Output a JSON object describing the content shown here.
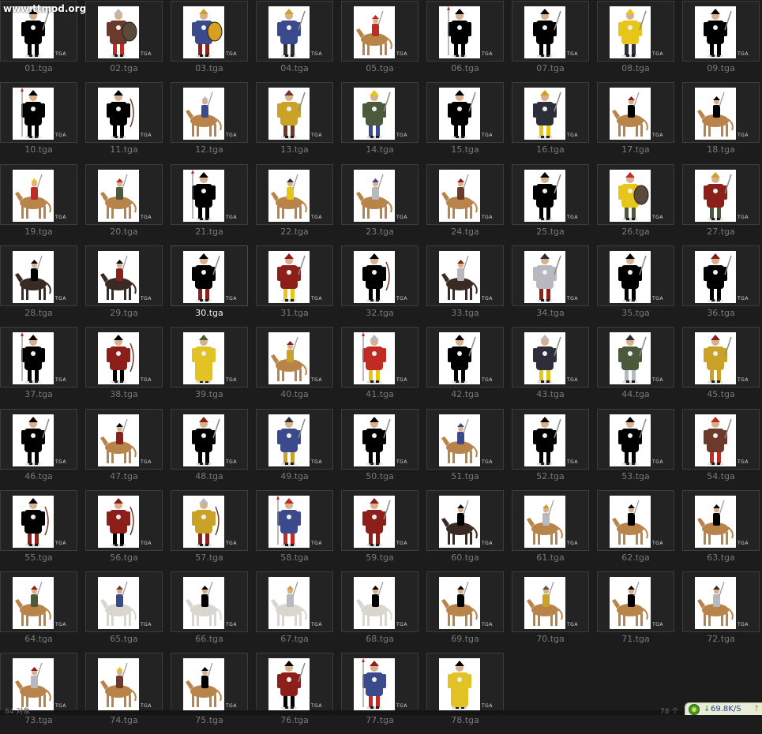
{
  "watermark": "www.ttmod.org",
  "thumbnail_badge": "TGA",
  "selected_index": 29,
  "files": [
    {
      "name": "01.tga",
      "subject": "infantry"
    },
    {
      "name": "02.tga",
      "subject": "infantry-shield"
    },
    {
      "name": "03.tga",
      "subject": "tiger-shield"
    },
    {
      "name": "04.tga",
      "subject": "infantry"
    },
    {
      "name": "05.tga",
      "subject": "cavalry"
    },
    {
      "name": "06.tga",
      "subject": "spearman"
    },
    {
      "name": "07.tga",
      "subject": "infantry"
    },
    {
      "name": "08.tga",
      "subject": "infantry"
    },
    {
      "name": "09.tga",
      "subject": "infantry"
    },
    {
      "name": "10.tga",
      "subject": "spearman"
    },
    {
      "name": "11.tga",
      "subject": "archer"
    },
    {
      "name": "12.tga",
      "subject": "cavalry"
    },
    {
      "name": "13.tga",
      "subject": "infantry"
    },
    {
      "name": "14.tga",
      "subject": "infantry"
    },
    {
      "name": "15.tga",
      "subject": "infantry"
    },
    {
      "name": "16.tga",
      "subject": "infantry"
    },
    {
      "name": "17.tga",
      "subject": "cavalry"
    },
    {
      "name": "18.tga",
      "subject": "cavalry"
    },
    {
      "name": "19.tga",
      "subject": "cavalry"
    },
    {
      "name": "20.tga",
      "subject": "cavalry"
    },
    {
      "name": "21.tga",
      "subject": "spearman"
    },
    {
      "name": "22.tga",
      "subject": "cavalry"
    },
    {
      "name": "23.tga",
      "subject": "cavalry"
    },
    {
      "name": "24.tga",
      "subject": "cavalry"
    },
    {
      "name": "25.tga",
      "subject": "infantry"
    },
    {
      "name": "26.tga",
      "subject": "infantry-shield"
    },
    {
      "name": "27.tga",
      "subject": "infantry"
    },
    {
      "name": "28.tga",
      "subject": "cavalry-dark"
    },
    {
      "name": "29.tga",
      "subject": "cavalry-dark"
    },
    {
      "name": "30.tga",
      "subject": "infantry"
    },
    {
      "name": "31.tga",
      "subject": "infantry"
    },
    {
      "name": "32.tga",
      "subject": "archer"
    },
    {
      "name": "33.tga",
      "subject": "cavalry-dark"
    },
    {
      "name": "34.tga",
      "subject": "infantry"
    },
    {
      "name": "35.tga",
      "subject": "infantry"
    },
    {
      "name": "36.tga",
      "subject": "infantry"
    },
    {
      "name": "37.tga",
      "subject": "spearman"
    },
    {
      "name": "38.tga",
      "subject": "archer"
    },
    {
      "name": "39.tga",
      "subject": "robe"
    },
    {
      "name": "40.tga",
      "subject": "cavalry"
    },
    {
      "name": "41.tga",
      "subject": "spearman"
    },
    {
      "name": "42.tga",
      "subject": "infantry"
    },
    {
      "name": "43.tga",
      "subject": "infantry"
    },
    {
      "name": "44.tga",
      "subject": "infantry"
    },
    {
      "name": "45.tga",
      "subject": "infantry"
    },
    {
      "name": "46.tga",
      "subject": "infantry"
    },
    {
      "name": "47.tga",
      "subject": "cavalry"
    },
    {
      "name": "48.tga",
      "subject": "infantry"
    },
    {
      "name": "49.tga",
      "subject": "infantry"
    },
    {
      "name": "50.tga",
      "subject": "infantry"
    },
    {
      "name": "51.tga",
      "subject": "cavalry"
    },
    {
      "name": "52.tga",
      "subject": "infantry"
    },
    {
      "name": "53.tga",
      "subject": "infantry"
    },
    {
      "name": "54.tga",
      "subject": "infantry"
    },
    {
      "name": "55.tga",
      "subject": "archer"
    },
    {
      "name": "56.tga",
      "subject": "archer"
    },
    {
      "name": "57.tga",
      "subject": "archer"
    },
    {
      "name": "58.tga",
      "subject": "spearman"
    },
    {
      "name": "59.tga",
      "subject": "infantry"
    },
    {
      "name": "60.tga",
      "subject": "cavalry-dark"
    },
    {
      "name": "61.tga",
      "subject": "cavalry"
    },
    {
      "name": "62.tga",
      "subject": "cavalry"
    },
    {
      "name": "63.tga",
      "subject": "cavalry"
    },
    {
      "name": "64.tga",
      "subject": "cavalry"
    },
    {
      "name": "65.tga",
      "subject": "cavalry-white"
    },
    {
      "name": "66.tga",
      "subject": "cavalry-white"
    },
    {
      "name": "67.tga",
      "subject": "cavalry-white"
    },
    {
      "name": "68.tga",
      "subject": "cavalry-white"
    },
    {
      "name": "69.tga",
      "subject": "cavalry"
    },
    {
      "name": "70.tga",
      "subject": "cavalry"
    },
    {
      "name": "71.tga",
      "subject": "cavalry"
    },
    {
      "name": "72.tga",
      "subject": "cavalry"
    },
    {
      "name": "73.tga",
      "subject": "cavalry"
    },
    {
      "name": "74.tga",
      "subject": "cavalry"
    },
    {
      "name": "75.tga",
      "subject": "cavalry"
    },
    {
      "name": "76.tga",
      "subject": "infantry"
    },
    {
      "name": "77.tga",
      "subject": "spearman"
    },
    {
      "name": "78.tga",
      "subject": "robe"
    }
  ],
  "palette": [
    "#8c1f1a",
    "#2e2e3a",
    "#c9a227",
    "#3b4a8c",
    "#c22b23",
    "#e6c619",
    "#4a5a3a",
    "#6b3a2a",
    "#b8b8c0"
  ],
  "status_bar": {
    "left_text": "84 对象",
    "mid_text": "78 个",
    "download_speed": "69.8K/S"
  }
}
